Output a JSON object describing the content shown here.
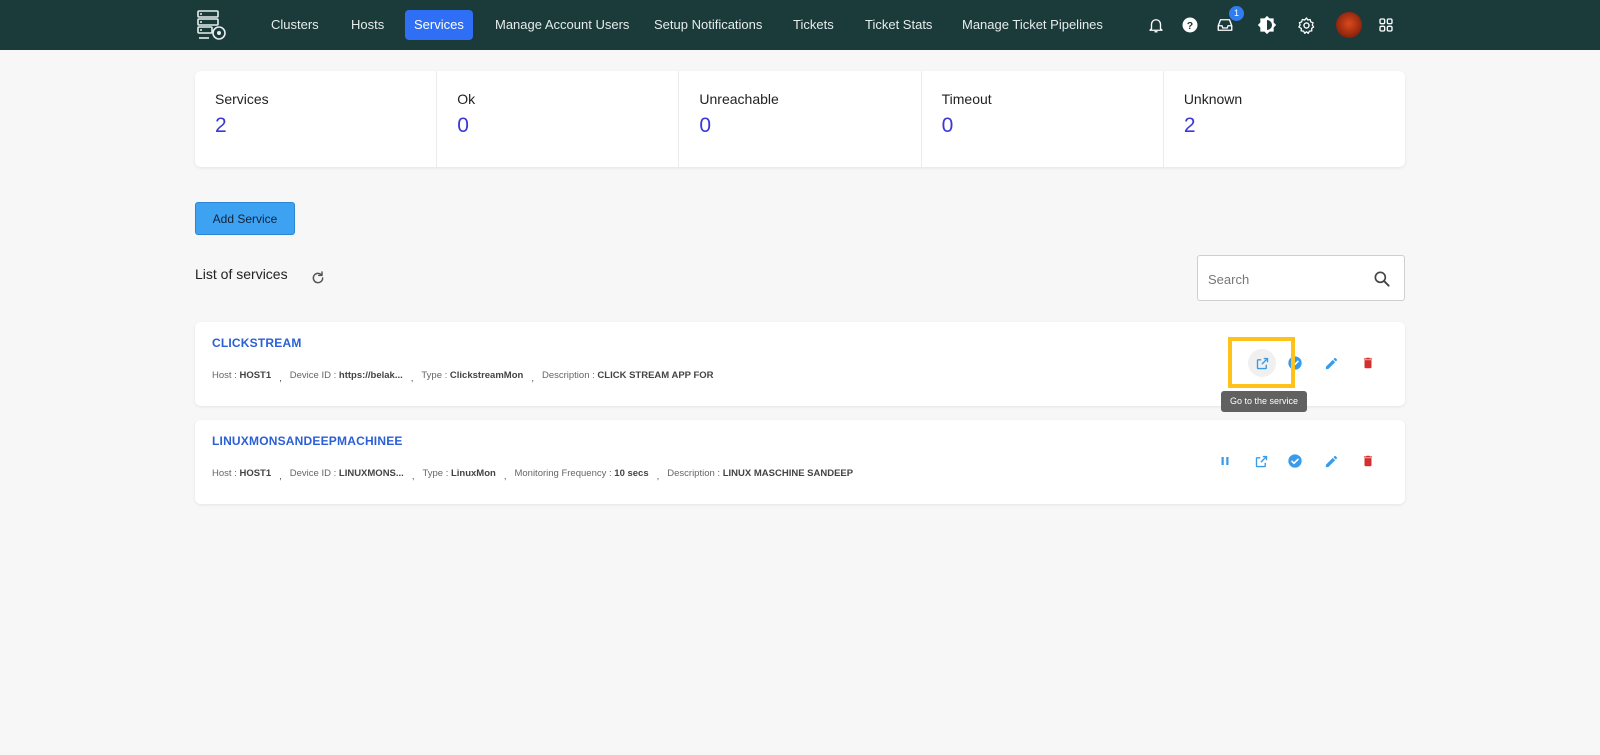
{
  "nav": {
    "items": [
      {
        "label": "Clusters",
        "active": false
      },
      {
        "label": "Hosts",
        "active": false
      },
      {
        "label": "Services",
        "active": true
      },
      {
        "label": "Manage Account Users",
        "active": false
      },
      {
        "label": "Setup Notifications",
        "active": false
      },
      {
        "label": "Tickets",
        "active": false
      },
      {
        "label": "Ticket Stats",
        "active": false
      },
      {
        "label": "Manage Ticket Pipelines",
        "active": false
      }
    ],
    "inbox_badge": "1",
    "icons": [
      "bell-icon",
      "help-icon",
      "inbox-icon",
      "theme-icon",
      "gear-icon",
      "avatar",
      "apps-grid-icon"
    ]
  },
  "stats": [
    {
      "label": "Services",
      "value": "2"
    },
    {
      "label": "Ok",
      "value": "0"
    },
    {
      "label": "Unreachable",
      "value": "0"
    },
    {
      "label": "Timeout",
      "value": "0"
    },
    {
      "label": "Unknown",
      "value": "2"
    }
  ],
  "add_button": "Add Service",
  "list_title": "List of services",
  "search": {
    "placeholder": "Search"
  },
  "services": [
    {
      "name": "CLICKSTREAM",
      "host_label": "Host :",
      "host": "HOST1",
      "device_label": "Device ID :",
      "device": "https://belak...",
      "type_label": "Type :",
      "type": "ClickstreamMon",
      "description_label": "Description :",
      "description": "CLICK STREAM APP FOR"
    },
    {
      "name": "LINUXMONSANDEEPMACHINEE",
      "host_label": "Host :",
      "host": "HOST1",
      "device_label": "Device ID :",
      "device": "LINUXMONS...",
      "type_label": "Type :",
      "type": "LinuxMon",
      "frequency_label": "Monitoring Frequency :",
      "frequency": "10 secs",
      "description_label": "Description :",
      "description": "LINUX MASCHINE SANDEEP"
    }
  ],
  "tooltip": "Go to the service",
  "colors": {
    "topbar": "#1b3a3a",
    "active_nav": "#2f6ff5",
    "stat_value": "#3b38d6",
    "link": "#2a5fd6",
    "action_blue": "#3a9be8",
    "delete_red": "#d32f2f",
    "highlight": "#ffc21a"
  }
}
